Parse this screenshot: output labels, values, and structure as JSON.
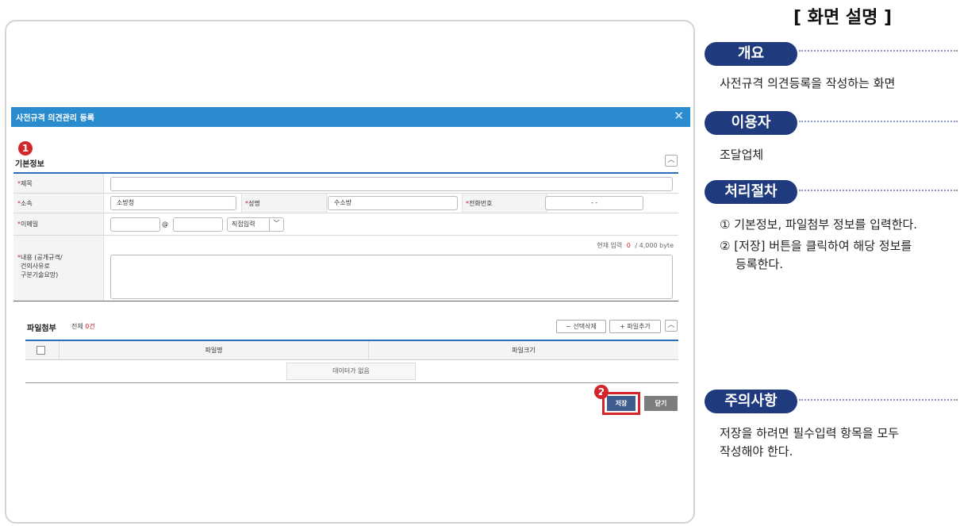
{
  "modal": {
    "title": "사전규격 의견관리 등록",
    "close": "✕"
  },
  "markers": [
    "1",
    "2"
  ],
  "basic": {
    "section_title": "기본정보",
    "collapse": "︿",
    "required_mark": "*",
    "title_label": "제목",
    "dept_label": "소속",
    "dept_value": "소방청",
    "name_label": "성명",
    "name_value": "수소방",
    "phone_label": "전화번호",
    "phone_value": "-      -",
    "email_label": "이메일",
    "email_at": "@",
    "email_direct": "직접입력",
    "email_dropdown": "﹀",
    "content_label_1": "내용 (공개규격/",
    "content_label_2": "건의사유로",
    "content_label_3": "구분기술요망)",
    "byte_prefix": "현재 입력",
    "byte_count": "0",
    "byte_suffix": "/ 4,000 byte"
  },
  "attach": {
    "section_title": "파일첨부",
    "total_prefix": "전체",
    "total_count": "0건",
    "delete_btn": "− 선택삭제",
    "add_btn": "+ 파일추가",
    "collapse": "︿",
    "col_file": "파일명",
    "col_size": "파일크기",
    "empty": "데이터가 없음"
  },
  "actions": {
    "save": "저장",
    "close": "닫기"
  },
  "description": {
    "title": "[ 화면 설명 ]",
    "overview_heading": "개요",
    "overview_text": "사전규격 의견등록을 작성하는 화면",
    "user_heading": "이용자",
    "user_text": "조달업체",
    "process_heading": "처리절차",
    "step1": "① 기본정보, 파일첨부 정보를 입력한다.",
    "step2_line1": "② [저장] 버튼을 클릭하여 해당 정보를",
    "step2_line2": "등록한다.",
    "caution_heading": "주의사항",
    "caution_line1": "저장을 하려면 필수입력 항목을 모두",
    "caution_line2": "작성해야 한다."
  },
  "colors": {
    "header_blue": "#2a8bcf",
    "pill_navy": "#1f3a7d",
    "marker_red": "#d3262b",
    "save_btn": "#3e5c8e",
    "close_btn": "#7d7d7d"
  }
}
